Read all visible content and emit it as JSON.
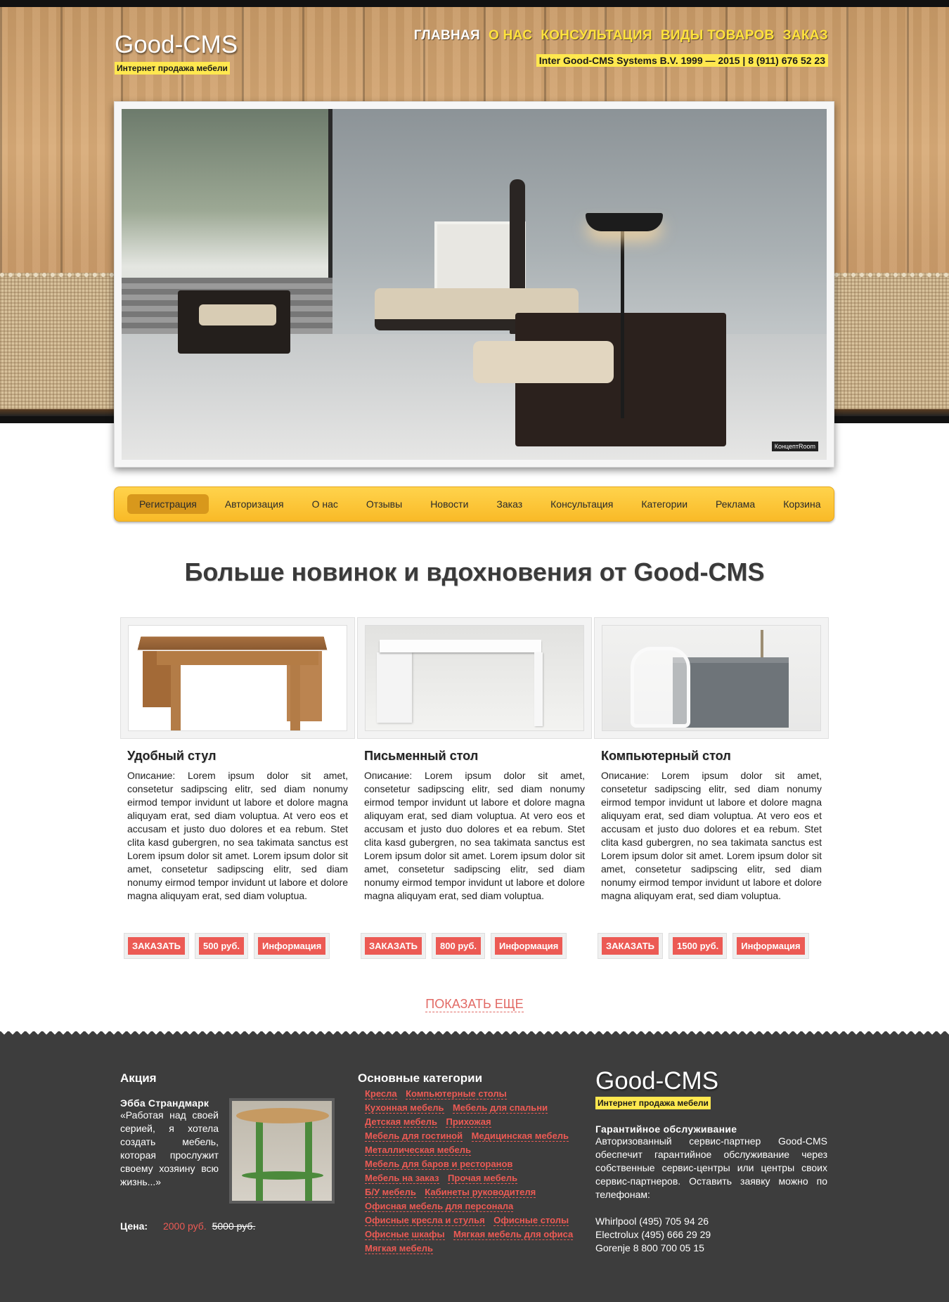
{
  "header": {
    "logo_title": "Good-CMS",
    "logo_subtitle": "Интернет продажа мебели",
    "nav": [
      "ГЛАВНАЯ",
      "О НАС",
      "КОНСУЛЬТАЦИЯ",
      "ВИДЫ ТОВАРОВ",
      "ЗАКАЗ"
    ],
    "contact": "Inter Good-CMS Systems B.V. 1999 — 2015 | 8 (911) 676 52 23"
  },
  "hero": {
    "badge": "КонцептRoom"
  },
  "subnav": [
    "Регистрация",
    "Авторизация",
    "О нас",
    "Отзывы",
    "Новости",
    "Заказ",
    "Консультация",
    "Категории",
    "Реклама",
    "Корзина"
  ],
  "section_title": "Больше новинок и вдохновения от Good-CMS",
  "products": [
    {
      "title": "Удобный стул",
      "description": "Описание: Lorem ipsum dolor sit amet, consetetur sadipscing elitr, sed diam nonumy eirmod tempor invidunt ut labore et dolore magna aliquyam erat, sed diam voluptua. At vero eos et accusam et justo duo dolores et ea rebum. Stet clita kasd gubergren, no sea takimata sanctus est Lorem ipsum dolor sit amet. Lorem ipsum dolor sit amet, consetetur sadipscing elitr, sed diam nonumy eirmod tempor invidunt ut labore et dolore magna aliquyam erat, sed diam voluptua.",
      "order_label": "ЗАКАЗАТЬ",
      "price": "500 руб.",
      "info_label": "Информация"
    },
    {
      "title": "Письменный стол",
      "description": "Описание: Lorem ipsum dolor sit amet, consetetur sadipscing elitr, sed diam nonumy eirmod tempor invidunt ut labore et dolore magna aliquyam erat, sed diam voluptua. At vero eos et accusam et justo duo dolores et ea rebum. Stet clita kasd gubergren, no sea takimata sanctus est Lorem ipsum dolor sit amet. Lorem ipsum dolor sit amet, consetetur sadipscing elitr, sed diam nonumy eirmod tempor invidunt ut labore et dolore magna aliquyam erat, sed diam voluptua.",
      "order_label": "ЗАКАЗАТЬ",
      "price": "800 руб.",
      "info_label": "Информация"
    },
    {
      "title": "Компьютерный стол",
      "description": "Описание: Lorem ipsum dolor sit amet, consetetur sadipscing elitr, sed diam nonumy eirmod tempor invidunt ut labore et dolore magna aliquyam erat, sed diam voluptua. At vero eos et accusam et justo duo dolores et ea rebum. Stet clita kasd gubergren, no sea takimata sanctus est Lorem ipsum dolor sit amet. Lorem ipsum dolor sit amet, consetetur sadipscing elitr, sed diam nonumy eirmod tempor invidunt ut labore et dolore magna aliquyam erat, sed diam voluptua.",
      "order_label": "ЗАКАЗАТЬ",
      "price": "1500 руб.",
      "info_label": "Информация"
    }
  ],
  "show_more": "ПОКАЗАТЬ ЕЩЕ",
  "footer": {
    "promo": {
      "heading": "Акция",
      "name": "Эбба Страндмарк",
      "quote": "«Работая над своей серией, я хотела создать мебель, которая прослужит своему хозяину всю жизнь...»",
      "price_label": "Цена:",
      "price_new": "2000 руб.",
      "price_old": "5000 руб."
    },
    "categories": {
      "heading": "Основные категории",
      "items": [
        "Кресла",
        "Компьютерные столы",
        "Кухонная мебель",
        "Мебель для спальни",
        "Детская мебель",
        "Прихожая",
        "Мебель для гостиной",
        "Медицинская мебель",
        "Металлическая мебель",
        "Мебель для баров и ресторанов",
        "Мебель на заказ",
        "Прочая мебель",
        "Б/У мебель",
        "Кабинеты руководителя",
        "Офисная мебель для персонала",
        "Офисные кресла и стулья",
        "Офисные столы",
        "Офисные шкафы",
        "Мягкая мебель для офиса",
        "Мягкая мебель"
      ]
    },
    "brand": {
      "logo_title": "Good-CMS",
      "logo_subtitle": "Интернет продажа мебели",
      "warranty_title": "Гарантийное обслуживание",
      "warranty_text": "Авторизованный сервис-партнер Good-CMS обеспечит гарантийное обслуживание через собственные сервис-центры или центры своих сервис-партнеров. Оставить заявку можно по телефонам:",
      "phones": [
        "Whirlpool (495) 705 94 26",
        "Electrolux (495) 666 29 29",
        "Gorenje 8 800 700 05 15"
      ]
    }
  }
}
